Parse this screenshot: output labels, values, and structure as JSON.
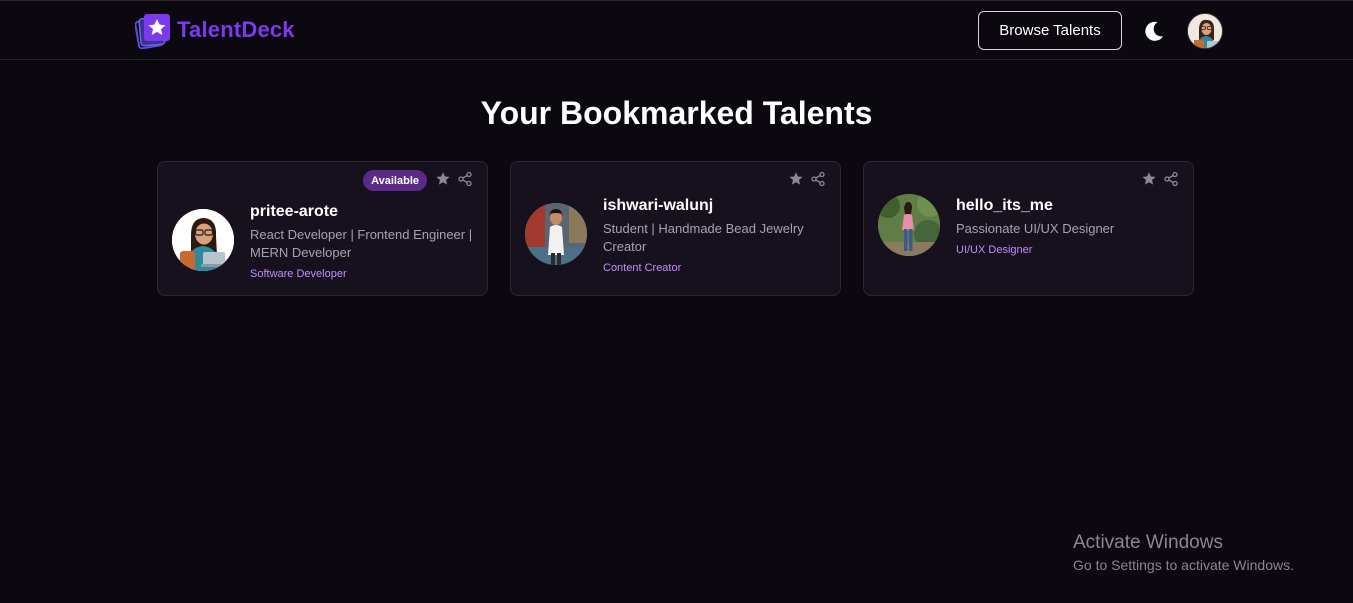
{
  "header": {
    "brand": "TalentDeck",
    "browse_label": "Browse Talents",
    "icons": {
      "logo": "star-deck-logo-icon",
      "theme": "moon-icon",
      "profile": "user-avatar"
    }
  },
  "page": {
    "title": "Your Bookmarked Talents"
  },
  "colors": {
    "background": "#0b080f",
    "card": "#16111d",
    "accent": "#7c3aed",
    "category": "#c48bff",
    "badge": "#5b2a86"
  },
  "cards": [
    {
      "name": "pritee-arote",
      "bio": "React Developer | Frontend Engineer | MERN Developer",
      "category": "Software Developer",
      "badge": "Available",
      "icons": [
        "star-icon",
        "share-icon"
      ]
    },
    {
      "name": "ishwari-walunj",
      "bio": "Student | Handmade Bead Jewelry Creator",
      "category": "Content Creator",
      "icons": [
        "star-icon",
        "share-icon"
      ]
    },
    {
      "name": "hello_its_me",
      "bio": "Passionate UI/UX Designer",
      "category": "UI/UX Designer",
      "icons": [
        "star-icon",
        "share-icon"
      ]
    }
  ],
  "watermark": {
    "title": "Activate Windows",
    "subtitle": "Go to Settings to activate Windows."
  }
}
